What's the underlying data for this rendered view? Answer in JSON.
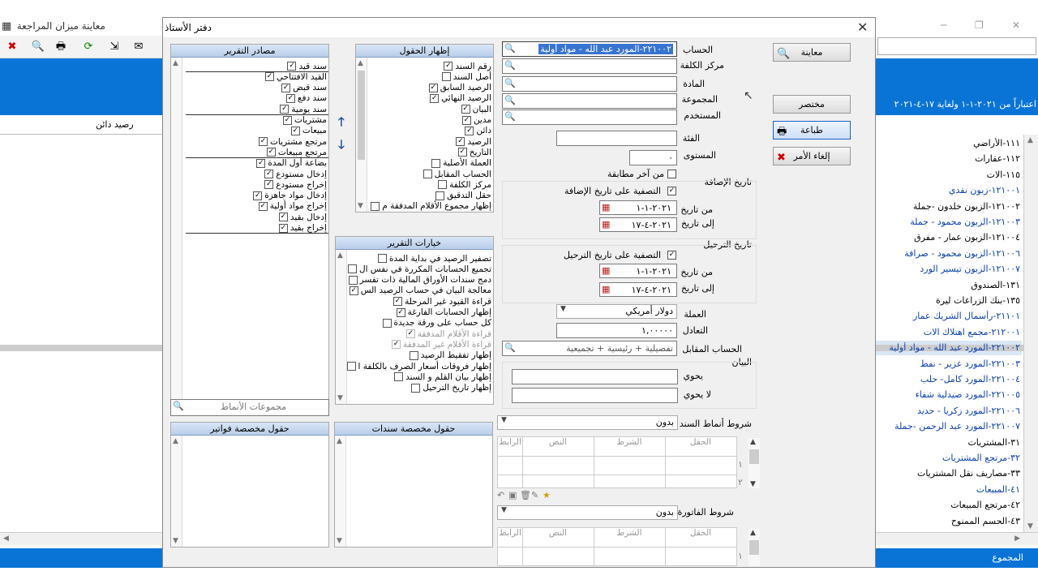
{
  "background": {
    "title": "معاينة ميزان المراجعة",
    "period": "اعتباراً من ٢٠٢١-١-١ ولغاية ١٧-٤-٢٠٢١",
    "column_label": "رصيد دائن",
    "footer_label": "المجموع",
    "accounts": [
      {
        "text": "١١١-الأراضي",
        "blue": false
      },
      {
        "text": "١١٢-عقارات",
        "blue": false
      },
      {
        "text": "١١٥-الات",
        "blue": false
      },
      {
        "text": "١٢١٠٠١-زبون نقدي",
        "blue": true
      },
      {
        "text": "١٢١٠٠٢-الزبون خلدون -جملة",
        "blue": false
      },
      {
        "text": "١٢١٠٠٣-الزبون محمود - جملة",
        "blue": true
      },
      {
        "text": "١٢١٠٠٤-الزبون عمار - مفرق",
        "blue": false
      },
      {
        "text": "١٢١٠٠٦-الزبون محمود - صرافة",
        "blue": true
      },
      {
        "text": "١٢١٠٠٧-الزبون تيسير الورد",
        "blue": true
      },
      {
        "text": "١٣١-الصندوق",
        "blue": false
      },
      {
        "text": "١٣٥-بنك الزراعات ليرة",
        "blue": false
      },
      {
        "text": "٢١١٠١-رأسمال الشريك عمار",
        "blue": true
      },
      {
        "text": "٢١٢٠٠١-مجمع اهتلاك الات",
        "blue": true
      },
      {
        "text": "٢٢١٠٠٢-المورد عبد الله - مواد أولية",
        "blue": true
      },
      {
        "text": "٢٢١٠٠٣-المورد عزير - نفط",
        "blue": true
      },
      {
        "text": "٢٢١٠٠٤-المورد كامل- حلب",
        "blue": true
      },
      {
        "text": "٢٢١٠٠٥-المورد صيدلية شفاء",
        "blue": true
      },
      {
        "text": "٢٢١٠٠٦-المورد زكريا - حديد",
        "blue": true
      },
      {
        "text": "٢٢١٠٠٧-المورد عبد الرحمن -جملة",
        "blue": true
      },
      {
        "text": "٣١-المشتريات",
        "blue": false
      },
      {
        "text": "٣٢-مرتجع المشتريات",
        "blue": true
      },
      {
        "text": "٣٣-مصاريف نقل المشتريات",
        "blue": false
      },
      {
        "text": "٤١-المبيعات",
        "blue": true
      },
      {
        "text": "٤٢-مرتجع المبيعات",
        "blue": false
      },
      {
        "text": "٤٣-الحسم الممنوح",
        "blue": false
      }
    ]
  },
  "dialog": {
    "title": "دفتر الأستاذ",
    "sources": {
      "header": "مصادر التقرير",
      "items": [
        {
          "label": "سند قيد",
          "checked": true
        },
        {
          "label": "القيد الافتتاحي",
          "checked": true
        },
        {
          "label": "سند قبض",
          "checked": true
        },
        {
          "label": "سند دفع",
          "checked": true
        },
        {
          "label": "سند يومية",
          "checked": true
        },
        {
          "label": "مشتريات",
          "checked": true
        },
        {
          "label": "مبيعات",
          "checked": true
        },
        {
          "label": "مرتجع مشتريات",
          "checked": true
        },
        {
          "label": "مرتجع مبيعات",
          "checked": true
        },
        {
          "label": "بضاعة أول المدة",
          "checked": true
        },
        {
          "label": "إدخال مستودع",
          "checked": true
        },
        {
          "label": "إخراج مستودع",
          "checked": true
        },
        {
          "label": "إدخال مواد جاهزة",
          "checked": true
        },
        {
          "label": "إخراج مواد أولية",
          "checked": true
        },
        {
          "label": "إدخال بقيد",
          "checked": true
        },
        {
          "label": "إخراج بقيد",
          "checked": true
        }
      ],
      "patterns_placeholder": "مجموعات الأنماط"
    },
    "fields": {
      "header": "إظهار الحقول",
      "items": [
        {
          "label": "رقم السند",
          "checked": true
        },
        {
          "label": "أصل السند",
          "checked": false
        },
        {
          "label": "الرصيد السابق",
          "checked": true
        },
        {
          "label": "الرصيد النهائي",
          "checked": true
        },
        {
          "label": "البيان",
          "checked": true
        },
        {
          "label": "مدين",
          "checked": true
        },
        {
          "label": "دائن",
          "checked": true
        },
        {
          "label": "الرصيد",
          "checked": true
        },
        {
          "label": "التاريخ",
          "checked": true
        },
        {
          "label": "العملة الأصلية",
          "checked": false
        },
        {
          "label": "الحساب المقابل",
          "checked": false
        },
        {
          "label": "مركز الكلفة",
          "checked": false
        },
        {
          "label": "حقل التدقيق",
          "checked": false
        },
        {
          "label": "إظهار مجموع الأقلام المدفقة م",
          "checked": false
        }
      ]
    },
    "options": {
      "header": "خيارات التقرير",
      "items": [
        {
          "label": "تصفير الرصيد في بداية المدة",
          "checked": false,
          "gray": false
        },
        {
          "label": "تجميع الحسابات المكررة في نفس ال",
          "checked": false,
          "gray": false
        },
        {
          "label": "دمج سندات الأوراق المالية ذات تفسر",
          "checked": false,
          "gray": false
        },
        {
          "label": "معالجة البيان في حساب الرصيد الس",
          "checked": true,
          "gray": false
        },
        {
          "label": "قراءة القيود غير المرحلة",
          "checked": true,
          "gray": false
        },
        {
          "label": "إظهار الحسابات الفارغة",
          "checked": true,
          "gray": false
        },
        {
          "label": "كل حساب على ورقة جديدة",
          "checked": false,
          "gray": false
        },
        {
          "label": "قراءة الأقلام المدفقة",
          "checked": true,
          "gray": true
        },
        {
          "label": "قراءة الأقلام غير المدفقة",
          "checked": true,
          "gray": true
        },
        {
          "label": "إظهار تفقيط الرصيد",
          "checked": false,
          "gray": false
        },
        {
          "label": "إظهار فروقات أسعار الصرف بالكلفة ا",
          "checked": false,
          "gray": false
        },
        {
          "label": "إظهار بيان القلم و السند",
          "checked": false,
          "gray": false
        },
        {
          "label": "إظهار تاريخ الترحيل",
          "checked": false,
          "gray": false
        }
      ]
    },
    "invoice_fields_header": "حقول مخصصة فواتير",
    "voucher_fields_header": "حقول مخصصة سندات",
    "labels": {
      "account": "الحساب",
      "cost_center": "مركز الكلفة",
      "material": "المادة",
      "group": "المجموعة",
      "user": "المستخدم",
      "category": "الفئة",
      "level": "المستوى",
      "last_match": "من آخر مطابقة",
      "add_date": "تاريخ الإضافة",
      "filter_add_date": "التصفية على تاريخ الإضافة",
      "from_date": "من تاريخ",
      "to_date": "إلى تاريخ",
      "post_date": "تاريخ الترحيل",
      "filter_post_date": "التصفية على تاريخ الترحيل",
      "currency": "العملة",
      "rate": "التعادل",
      "counter_account": "الحساب المقابل",
      "statement": "البيان",
      "contains": "يحوي",
      "not_contains": "لا يحوي",
      "voucher_pattern_cond": "شروط أنماط السند",
      "invoice_cond": "شروط الفاتورة"
    },
    "values": {
      "account": "٢٢١٠٠٢-المورد عبد الله - مواد أولية",
      "level": "٠",
      "add_from": "٢٠٢١-١-١",
      "add_to": "٢٠٢١-٤-١٧",
      "post_from": "٢٠٢١-١-١",
      "post_to": "٢٠٢١-٤-١٧",
      "currency": "دولار أمريكي",
      "rate": "١,٠٠٠٠٠",
      "counter_account": "تفصيلية + رئيسية + تجميعية",
      "voucher_cond": "بدون",
      "invoice_cond": "بدون"
    },
    "grid_headers": {
      "field": "الحقل",
      "condition": "الشرط",
      "text": "النص",
      "link": "الرابط"
    },
    "grid_rows": [
      "١",
      "٢"
    ],
    "buttons": {
      "preview": "معاينة",
      "summary": "مختصر",
      "print": "طباعة",
      "cancel": "إلغاء الأمر"
    }
  }
}
